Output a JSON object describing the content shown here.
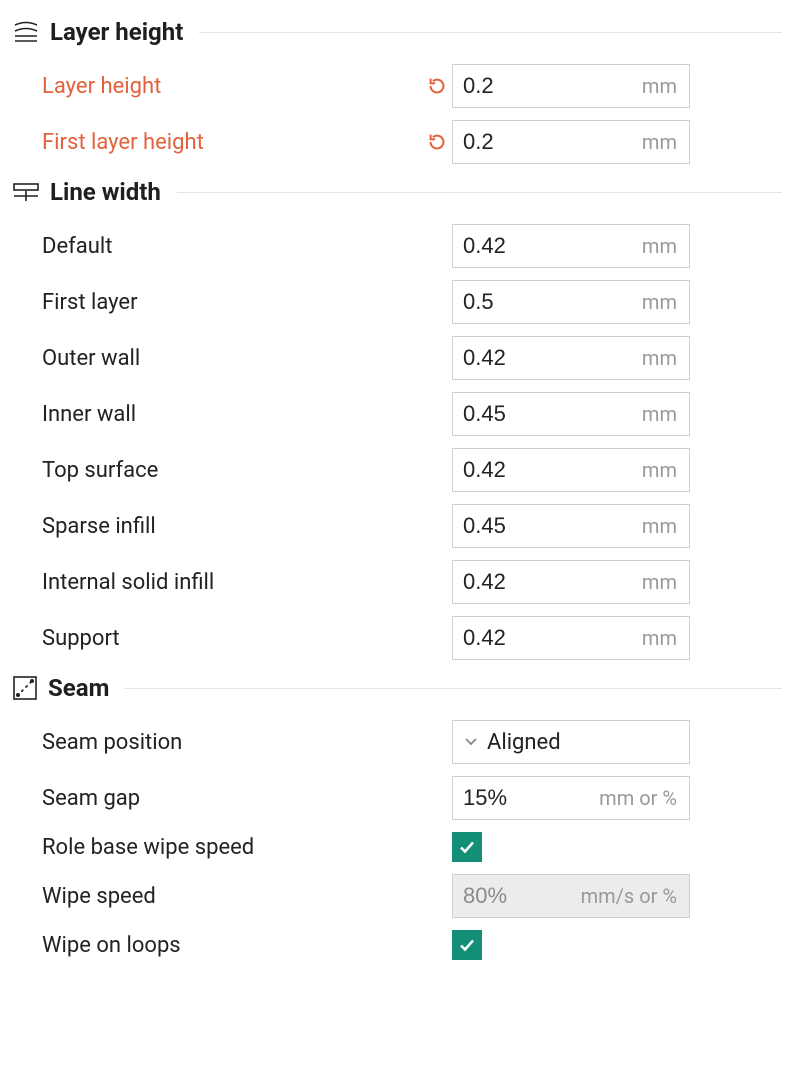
{
  "sections": {
    "layer_height": {
      "title": "Layer height",
      "layer_height": {
        "label": "Layer height",
        "value": "0.2",
        "unit": "mm"
      },
      "first_layer_height": {
        "label": "First layer height",
        "value": "0.2",
        "unit": "mm"
      }
    },
    "line_width": {
      "title": "Line width",
      "default": {
        "label": "Default",
        "value": "0.42",
        "unit": "mm"
      },
      "first_layer": {
        "label": "First layer",
        "value": "0.5",
        "unit": "mm"
      },
      "outer_wall": {
        "label": "Outer wall",
        "value": "0.42",
        "unit": "mm"
      },
      "inner_wall": {
        "label": "Inner wall",
        "value": "0.45",
        "unit": "mm"
      },
      "top_surface": {
        "label": "Top surface",
        "value": "0.42",
        "unit": "mm"
      },
      "sparse_infill": {
        "label": "Sparse infill",
        "value": "0.45",
        "unit": "mm"
      },
      "solid_infill": {
        "label": "Internal solid infill",
        "value": "0.42",
        "unit": "mm"
      },
      "support": {
        "label": "Support",
        "value": "0.42",
        "unit": "mm"
      }
    },
    "seam": {
      "title": "Seam",
      "position": {
        "label": "Seam position",
        "value": "Aligned"
      },
      "gap": {
        "label": "Seam gap",
        "value": "15%",
        "unit": "mm or %"
      },
      "role_wipe": {
        "label": "Role base wipe speed",
        "checked": true
      },
      "wipe_speed": {
        "label": "Wipe speed",
        "value": "80%",
        "unit": "mm/s or %",
        "disabled": true
      },
      "wipe_loops": {
        "label": "Wipe on loops",
        "checked": true
      }
    }
  }
}
